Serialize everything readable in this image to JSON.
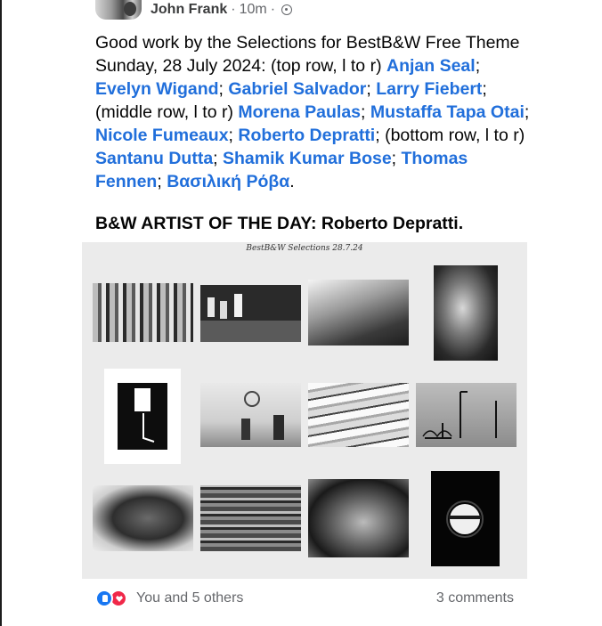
{
  "post": {
    "author": "John Frank",
    "separator_1": "·",
    "time": "10m",
    "separator_2": "·",
    "audience_icon": "globe-icon",
    "intro": "Good work by the Selections for BestB&W Free Theme Sunday, 28 July 2024: (top row, l to r) ",
    "tags": [
      "Anjan Seal",
      "Evelyn Wigand",
      "Gabriel Salvador",
      "Larry Fiebert",
      "Morena Paulas",
      "Mustaffa Tapa Otai",
      "Nicole Fumeaux",
      "Roberto Depratti",
      "Santanu Dutta",
      "Shamik Kumar Bose",
      "Thomas Fennen",
      "Βασιλική Ρόβα"
    ],
    "sep": "; ",
    "middle_row": "; (middle row, l to r) ",
    "bottom_row": "; (bottom row, l to r) ",
    "end": ".",
    "artist_of_day": "B&W ARTIST OF THE DAY: Roberto Depratti."
  },
  "collage": {
    "title": "BestB&W Selections 28.7.24",
    "photo_count": 12
  },
  "footer": {
    "reaction_icons": [
      "like-icon",
      "love-icon"
    ],
    "reactions_text": "You and 5 others",
    "comments_text": "3 comments"
  }
}
